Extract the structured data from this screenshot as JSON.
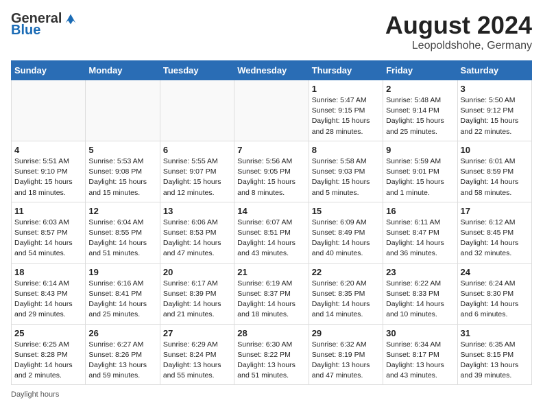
{
  "header": {
    "logo_general": "General",
    "logo_blue": "Blue",
    "month": "August 2024",
    "location": "Leopoldshohe, Germany"
  },
  "days_of_week": [
    "Sunday",
    "Monday",
    "Tuesday",
    "Wednesday",
    "Thursday",
    "Friday",
    "Saturday"
  ],
  "footer": "Daylight hours",
  "weeks": [
    [
      {
        "day": "",
        "info": ""
      },
      {
        "day": "",
        "info": ""
      },
      {
        "day": "",
        "info": ""
      },
      {
        "day": "",
        "info": ""
      },
      {
        "day": "1",
        "info": "Sunrise: 5:47 AM\nSunset: 9:15 PM\nDaylight: 15 hours\nand 28 minutes."
      },
      {
        "day": "2",
        "info": "Sunrise: 5:48 AM\nSunset: 9:14 PM\nDaylight: 15 hours\nand 25 minutes."
      },
      {
        "day": "3",
        "info": "Sunrise: 5:50 AM\nSunset: 9:12 PM\nDaylight: 15 hours\nand 22 minutes."
      }
    ],
    [
      {
        "day": "4",
        "info": "Sunrise: 5:51 AM\nSunset: 9:10 PM\nDaylight: 15 hours\nand 18 minutes."
      },
      {
        "day": "5",
        "info": "Sunrise: 5:53 AM\nSunset: 9:08 PM\nDaylight: 15 hours\nand 15 minutes."
      },
      {
        "day": "6",
        "info": "Sunrise: 5:55 AM\nSunset: 9:07 PM\nDaylight: 15 hours\nand 12 minutes."
      },
      {
        "day": "7",
        "info": "Sunrise: 5:56 AM\nSunset: 9:05 PM\nDaylight: 15 hours\nand 8 minutes."
      },
      {
        "day": "8",
        "info": "Sunrise: 5:58 AM\nSunset: 9:03 PM\nDaylight: 15 hours\nand 5 minutes."
      },
      {
        "day": "9",
        "info": "Sunrise: 5:59 AM\nSunset: 9:01 PM\nDaylight: 15 hours\nand 1 minute."
      },
      {
        "day": "10",
        "info": "Sunrise: 6:01 AM\nSunset: 8:59 PM\nDaylight: 14 hours\nand 58 minutes."
      }
    ],
    [
      {
        "day": "11",
        "info": "Sunrise: 6:03 AM\nSunset: 8:57 PM\nDaylight: 14 hours\nand 54 minutes."
      },
      {
        "day": "12",
        "info": "Sunrise: 6:04 AM\nSunset: 8:55 PM\nDaylight: 14 hours\nand 51 minutes."
      },
      {
        "day": "13",
        "info": "Sunrise: 6:06 AM\nSunset: 8:53 PM\nDaylight: 14 hours\nand 47 minutes."
      },
      {
        "day": "14",
        "info": "Sunrise: 6:07 AM\nSunset: 8:51 PM\nDaylight: 14 hours\nand 43 minutes."
      },
      {
        "day": "15",
        "info": "Sunrise: 6:09 AM\nSunset: 8:49 PM\nDaylight: 14 hours\nand 40 minutes."
      },
      {
        "day": "16",
        "info": "Sunrise: 6:11 AM\nSunset: 8:47 PM\nDaylight: 14 hours\nand 36 minutes."
      },
      {
        "day": "17",
        "info": "Sunrise: 6:12 AM\nSunset: 8:45 PM\nDaylight: 14 hours\nand 32 minutes."
      }
    ],
    [
      {
        "day": "18",
        "info": "Sunrise: 6:14 AM\nSunset: 8:43 PM\nDaylight: 14 hours\nand 29 minutes."
      },
      {
        "day": "19",
        "info": "Sunrise: 6:16 AM\nSunset: 8:41 PM\nDaylight: 14 hours\nand 25 minutes."
      },
      {
        "day": "20",
        "info": "Sunrise: 6:17 AM\nSunset: 8:39 PM\nDaylight: 14 hours\nand 21 minutes."
      },
      {
        "day": "21",
        "info": "Sunrise: 6:19 AM\nSunset: 8:37 PM\nDaylight: 14 hours\nand 18 minutes."
      },
      {
        "day": "22",
        "info": "Sunrise: 6:20 AM\nSunset: 8:35 PM\nDaylight: 14 hours\nand 14 minutes."
      },
      {
        "day": "23",
        "info": "Sunrise: 6:22 AM\nSunset: 8:33 PM\nDaylight: 14 hours\nand 10 minutes."
      },
      {
        "day": "24",
        "info": "Sunrise: 6:24 AM\nSunset: 8:30 PM\nDaylight: 14 hours\nand 6 minutes."
      }
    ],
    [
      {
        "day": "25",
        "info": "Sunrise: 6:25 AM\nSunset: 8:28 PM\nDaylight: 14 hours\nand 2 minutes."
      },
      {
        "day": "26",
        "info": "Sunrise: 6:27 AM\nSunset: 8:26 PM\nDaylight: 13 hours\nand 59 minutes."
      },
      {
        "day": "27",
        "info": "Sunrise: 6:29 AM\nSunset: 8:24 PM\nDaylight: 13 hours\nand 55 minutes."
      },
      {
        "day": "28",
        "info": "Sunrise: 6:30 AM\nSunset: 8:22 PM\nDaylight: 13 hours\nand 51 minutes."
      },
      {
        "day": "29",
        "info": "Sunrise: 6:32 AM\nSunset: 8:19 PM\nDaylight: 13 hours\nand 47 minutes."
      },
      {
        "day": "30",
        "info": "Sunrise: 6:34 AM\nSunset: 8:17 PM\nDaylight: 13 hours\nand 43 minutes."
      },
      {
        "day": "31",
        "info": "Sunrise: 6:35 AM\nSunset: 8:15 PM\nDaylight: 13 hours\nand 39 minutes."
      }
    ]
  ]
}
